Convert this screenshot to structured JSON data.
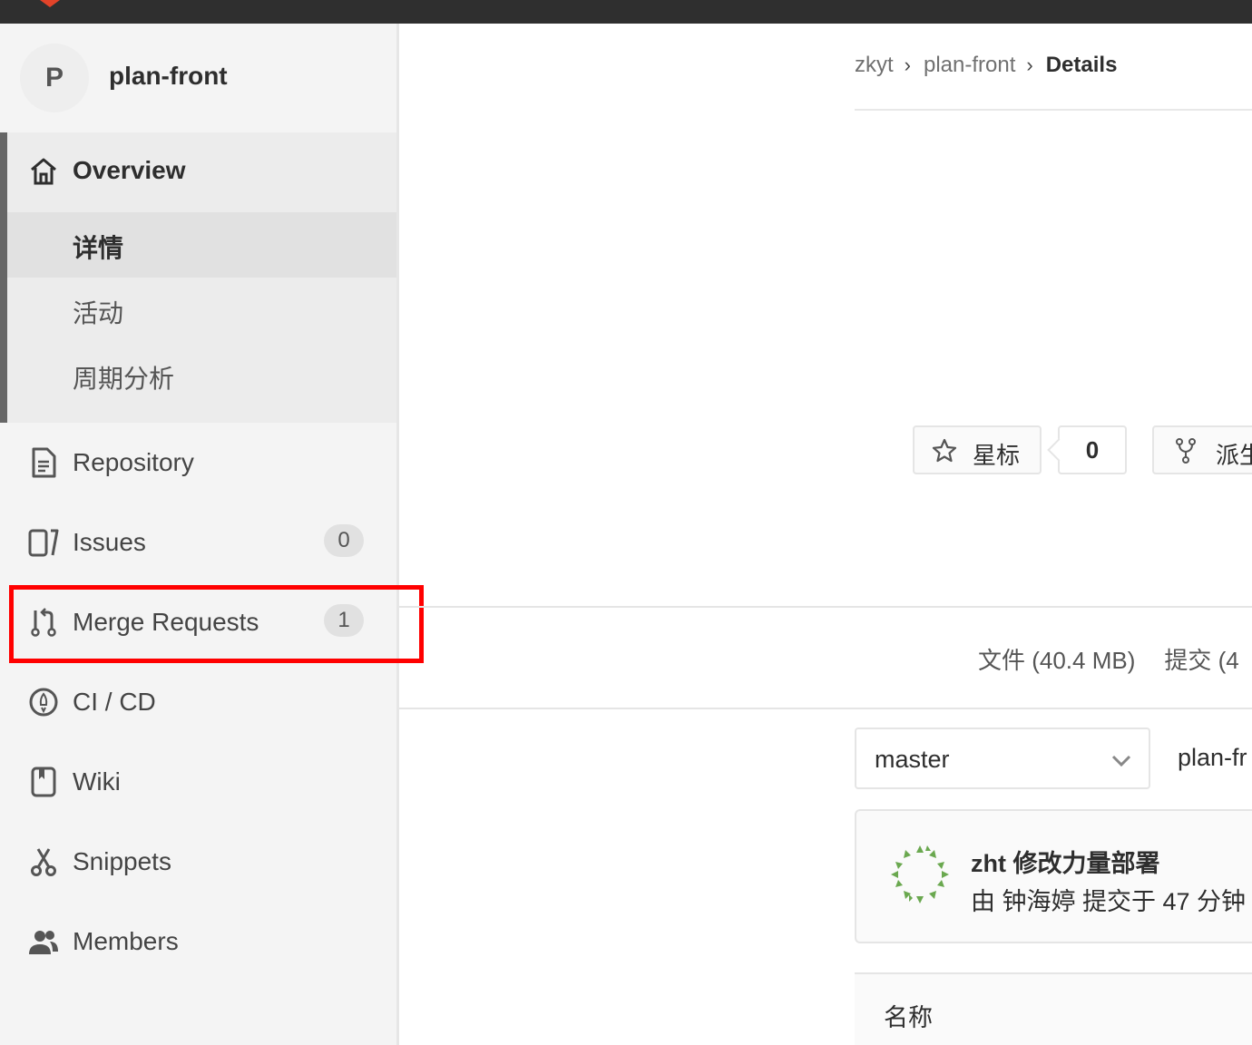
{
  "sidebar": {
    "project": {
      "avatar_letter": "P",
      "name": "plan-front"
    },
    "overview": {
      "label": "Overview",
      "items": [
        {
          "label": "详情",
          "active": true
        },
        {
          "label": "活动",
          "active": false
        },
        {
          "label": "周期分析",
          "active": false
        }
      ]
    },
    "nav": [
      {
        "label": "Repository",
        "icon": "file-icon"
      },
      {
        "label": "Issues",
        "icon": "issues-icon",
        "badge": "0"
      },
      {
        "label": "Merge Requests",
        "icon": "merge-request-icon",
        "badge": "1"
      },
      {
        "label": "CI / CD",
        "icon": "rocket-icon"
      },
      {
        "label": "Wiki",
        "icon": "book-icon"
      },
      {
        "label": "Snippets",
        "icon": "scissors-icon"
      },
      {
        "label": "Members",
        "icon": "users-icon"
      }
    ]
  },
  "breadcrumb": {
    "group": "zkyt",
    "project": "plan-front",
    "current": "Details"
  },
  "actions": {
    "star_label": "星标",
    "star_count": "0",
    "fork_label": "派生"
  },
  "stats": {
    "files": "文件 (40.4 MB)",
    "commits": "提交 (4"
  },
  "repo": {
    "branch": "master",
    "path": "plan-fr"
  },
  "commit": {
    "title": "zht 修改力量部署",
    "meta": "由 钟海婷 提交于 47 分钟"
  },
  "table": {
    "name_header": "名称"
  },
  "colors": {
    "highlight": "#ff0000",
    "sidebar_bg": "#f4f4f4",
    "active_bg": "#e1e1e1"
  }
}
